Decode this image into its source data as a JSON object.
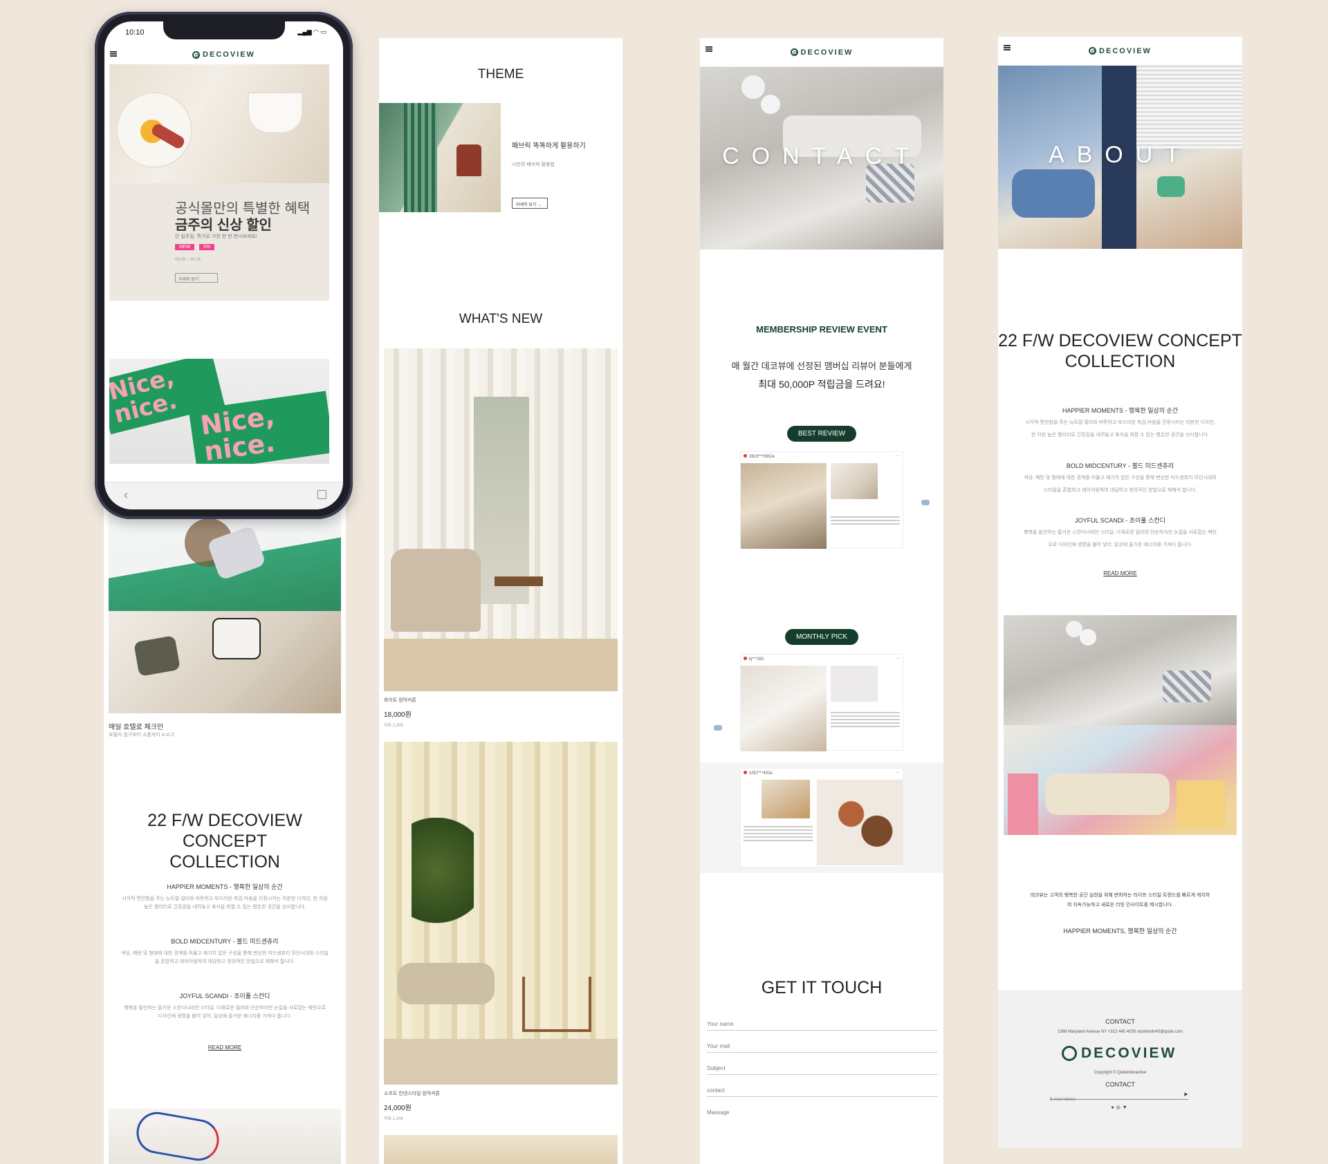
{
  "colors": {
    "background": "#efe6dc",
    "brand_green": "#143d2c",
    "accent_pink": "#f0428a"
  },
  "phone": {
    "time": "10:10",
    "logo": "DECOVIEW",
    "promo_line1": "공식몰만의 특별한 혜택",
    "promo_line2": "금주의 신상 할인",
    "promo_sub": "단 일주일, 특가로 가장 한 번 만나보세요!",
    "badge_new": "NEW",
    "badge_pct": "5%",
    "promo_date": "03.09 ~ 03.16",
    "promo_button": "자세히 보기"
  },
  "col1": {
    "item_title": "매일 호텔로 체크인",
    "item_sub": "호텔식 침구부터 소품까지 A to Z",
    "concept_title_1": "22 F/W DECOVIEW CONCEPT",
    "concept_title_2": "COLLECTION",
    "sections": [
      {
        "title": "HAPPIER MOMENTS - 행복한 일상의 순간",
        "body1": "시각적 편안함을 주는 뉴트럴 컬러와 따뜻하고 부드러운 촉감,마음을 진정시키는 차분한 디자인, 한 차원",
        "body2": "높은 퀄리티로 긴장감을 내려놓고 휴식을 취할 수 있는 평온한 공간을 선사합니다."
      },
      {
        "title": "BOLD MIDCENTURY - 볼드 미드센츄리",
        "body1": "색상, 패턴 및 형태에 대한 경계를 허물고 예기치 않은 구성을 통해 변신한 미드센츄리 모던시대와 스타일",
        "body2": "을 혼합하고 레이어링하여 대담하고 창의적인 방법으로 재해석 합니다."
      },
      {
        "title": "JOYFUL SCANDI - 조이풀 스칸디",
        "body1": "행복을 발산하는 즐거운 스칸디나비안 스타일. 다채로운 컬러와 단순하지만 눈길을 사로잡는 패턴으로",
        "body2": "디자인에 생명을 불어 넣어, 일상에 즐거운 에너지를 가져다 줍니다."
      }
    ],
    "read_more": "READ MORE"
  },
  "col2": {
    "theme_title": "THEME",
    "theme_item_title": "패브릭 똑똑하게 활용하기",
    "theme_item_sub": "나만의 패브릭 활용법",
    "theme_button": "자세히 보기 →",
    "whats_new_title": "WHAT'S NEW",
    "products": [
      {
        "name": "화이트 암막커튼",
        "price": "18,000원",
        "review": "리뷰 1,205"
      },
      {
        "name": "소프트 린넨스타일 암막커튼",
        "price": "24,000원",
        "review": "리뷰 1,144"
      }
    ]
  },
  "col3": {
    "logo": "DECOVIEW",
    "hero_word": "CONTACT",
    "event_title": "MEMBERSHIP REVIEW EVENT",
    "event_line1": "매 월간 데코뷰에 선정된 맴버십 리뷰어 분들에게",
    "event_line2": "최대 50,000P 적립금을 드려요!",
    "best_review": "BEST REVIEW",
    "monthly_pick": "MONTHLY PICK",
    "feed_user_1": "2623***0552e",
    "feed_user_2": "kj***282",
    "feed_user_3": "1057***402e",
    "get_in_touch": "GET IT TOUCH",
    "form_fields": [
      "Your name",
      "Your mail",
      "Subject",
      "contact",
      "Massage"
    ]
  },
  "col4": {
    "logo": "DECOVIEW",
    "hero_word": "ABOUT",
    "concept_title_1": "22 F/W DECOVIEW CONCEPT",
    "concept_title_2": "COLLECTION",
    "sections": [
      {
        "title": "HAPPIER MOMENTS - 행복한 일상의 순간",
        "body1": "시각적 편안함을 주는 뉴트럴 컬러와 따뜻하고 부드러운 촉감,마음을 진정시키는 차분한 디자인,",
        "body2": "한 차원 높은 퀄리티로 긴장감을 내려놓고 휴식을 취할 수 있는 평온한 공간을 선사합니다."
      },
      {
        "title": "BOLD MIDCENTURY - 볼드 미드센츄리",
        "body1": "색상, 패턴 및 형태에 대한 경계를 허물고 예기치 않은 구성을 통해 변신한 미드센츄리 모던시대와",
        "body2": "스타일을 혼합하고 레이어링하여 대담하고 창의적인 방법으로 재해석 합니다."
      },
      {
        "title": "JOYFUL SCANDI - 조이풀 스칸디",
        "body1": "행복을 발산하는 즐거운 스칸디나비안 스타일. 다채로운 컬러와 단순하지만 눈길을 사로잡는 패턴",
        "body2": "으로 디자인에 생명을 불어 넣어, 일상에 즐거운 에너지를 가져다 줍니다."
      }
    ],
    "read_more": "READ MORE",
    "brand_line1": "데코뷰는 고객의 행복한 공간 실현을 위해 변화하는 라이프 스타일 트렌드를 빠르게 캐치하",
    "brand_line2": "여 지속가능하고 새로운 리빙 인사이트를 제시합니다.",
    "brand_tag": "HAPPIER MOMENTS, 행복한 일상의 순간",
    "footer": {
      "contact_title": "CONTACT",
      "address": "1368 Maryland Avenue NY +312 445 4035 stockholm43@qode.com",
      "logo": "DECOVIEW",
      "copyright": "Copyright © Qodeinteractive",
      "contact_title_2": "CONTACT",
      "email_placeholder": "E-mail Adress"
    }
  }
}
